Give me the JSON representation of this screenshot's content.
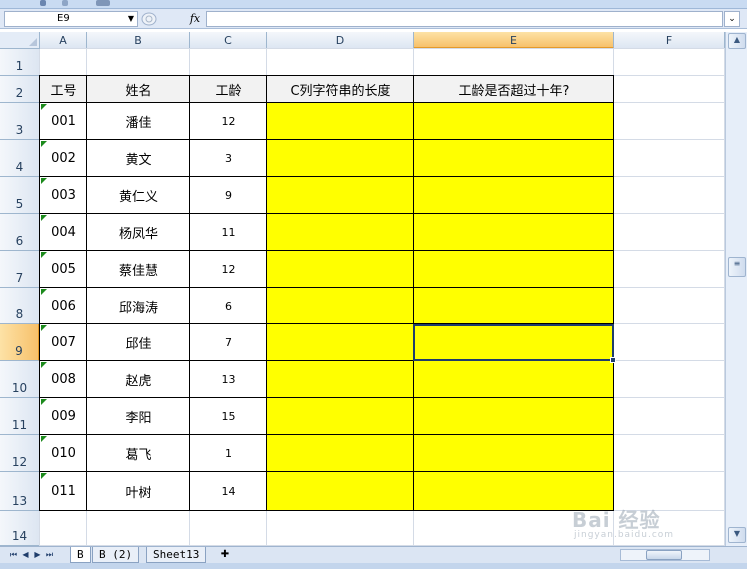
{
  "formula_bar": {
    "name_box": "E9",
    "fx_label": "fx",
    "formula": ""
  },
  "columns": [
    "A",
    "B",
    "C",
    "D",
    "E",
    "F"
  ],
  "rows": [
    "1",
    "2",
    "3",
    "4",
    "5",
    "6",
    "7",
    "8",
    "9",
    "10",
    "11",
    "12",
    "13",
    "14"
  ],
  "selected": {
    "column": "E",
    "row": "9"
  },
  "table": {
    "headers": [
      "工号",
      "姓名",
      "工龄",
      "C列字符串的长度",
      "工龄是否超过十年?"
    ],
    "rows": [
      [
        "001",
        "潘佳",
        "12"
      ],
      [
        "002",
        "黄文",
        "3"
      ],
      [
        "003",
        "黄仁义",
        "9"
      ],
      [
        "004",
        "杨凤华",
        "11"
      ],
      [
        "005",
        "蔡佳慧",
        "12"
      ],
      [
        "006",
        "邱海涛",
        "6"
      ],
      [
        "007",
        "邱佳",
        "7"
      ],
      [
        "008",
        "赵虎",
        "13"
      ],
      [
        "009",
        "李阳",
        "15"
      ],
      [
        "010",
        "葛飞",
        "1"
      ],
      [
        "011",
        "叶树",
        "14"
      ]
    ]
  },
  "sheet_tabs": [
    {
      "label": "B",
      "active": true
    },
    {
      "label": "B (2)",
      "active": false
    },
    {
      "label": "Sheet13",
      "active": false
    }
  ],
  "watermark": {
    "logo": "Bai 经验",
    "url": "jingyan.baidu.com"
  },
  "colors": {
    "highlight": "#ffff00",
    "header_fill": "#f2f2f2",
    "selection": "#1f3d6b"
  }
}
